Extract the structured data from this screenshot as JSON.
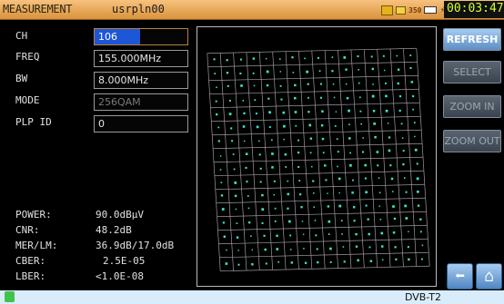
{
  "header": {
    "title": "MEASUREMENT",
    "user": "usrpln00",
    "icons": [
      "status-box-icon",
      "power-badge-icon",
      "battery-icon",
      "plug-icon"
    ],
    "icon_text": "350",
    "time": "00:03:47"
  },
  "params": {
    "ch_label": "CH",
    "ch_value": "106",
    "freq_label": "FREQ",
    "freq_value": "155.000MHz",
    "bw_label": "BW",
    "bw_value": "8.000MHz",
    "mode_label": "MODE",
    "mode_value": "256QAM",
    "plp_label": "PLP ID",
    "plp_value": "0"
  },
  "stats": {
    "power_label": "POWER:",
    "power_value": "90.0dBµV",
    "cnr_label": "CNR:",
    "cnr_value": "48.2dB",
    "mer_label": "MER/LM:",
    "mer_value": "36.9dB/17.0dB",
    "cber_label": "CBER:",
    "cber_value": "2.5E-05",
    "lber_label": "LBER:",
    "lber_value": "<1.0E-08"
  },
  "buttons": {
    "refresh": "REFRESH",
    "select": "SELECT",
    "zoom_in": "ZOOM IN",
    "zoom_out": "ZOOM OUT"
  },
  "nav": {
    "back_icon": "back-arrow-icon",
    "home_icon": "home-icon"
  },
  "footer": {
    "standard": "DVB-T2"
  },
  "constellation": {
    "modulation_grid": 16
  },
  "colors": {
    "header": "#e3a35a",
    "selected_field": "#1d57d8",
    "dots": "#3fe0c8",
    "button_active": "#7fb0e3",
    "time_text": "#d7ff2a"
  }
}
